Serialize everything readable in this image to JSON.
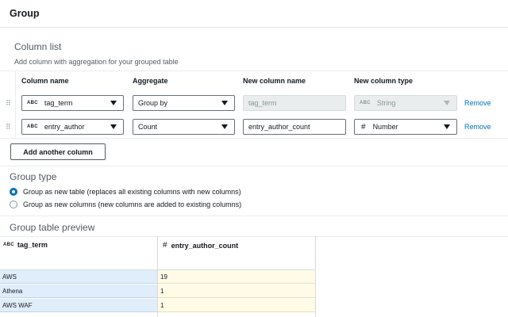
{
  "header": {
    "title": "Group"
  },
  "column_list": {
    "title": "Column list",
    "description": "Add column with aggregation for your grouped table",
    "headers": {
      "column_name": "Column name",
      "aggregate": "Aggregate",
      "new_column_name": "New column name",
      "new_column_type": "New column type"
    },
    "rows": [
      {
        "column_name": "tag_term",
        "column_type_badge": "ABC",
        "aggregate": "Group by",
        "new_column_name": "tag_term",
        "new_column_type": "String",
        "new_column_type_badge": "ABC",
        "remove": "Remove"
      },
      {
        "column_name": "entry_author",
        "column_type_badge": "ABC",
        "aggregate": "Count",
        "new_column_name": "entry_author_count",
        "new_column_type": "Number",
        "new_column_type_badge": "#",
        "remove": "Remove"
      }
    ],
    "add_button": "Add another column"
  },
  "group_type": {
    "title": "Group type",
    "options": [
      {
        "label": "Group as new table (replaces all existing columns with new columns)",
        "checked": true
      },
      {
        "label": "Group as new columns (new columns are added to existing columns)",
        "checked": false
      }
    ]
  },
  "preview": {
    "title": "Group table preview",
    "columns": [
      {
        "badge": "ABC",
        "name": "tag_term"
      },
      {
        "badge": "#",
        "name": "entry_author_count"
      }
    ],
    "rows": [
      [
        "AWS",
        "19"
      ],
      [
        "Athena",
        "1"
      ],
      [
        "AWS WAF",
        "1"
      ]
    ]
  },
  "colors": {
    "accent": "#0073bb",
    "key_cell_bg": "#e0eefb",
    "value_cell_bg": "#fffbe6"
  }
}
